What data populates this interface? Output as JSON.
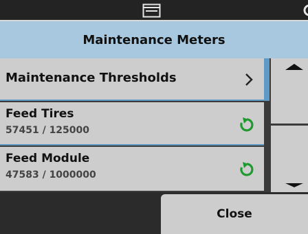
{
  "status_bar": {
    "center_icon": "display-icon"
  },
  "header": {
    "title": "Maintenance Meters"
  },
  "list": {
    "items": [
      {
        "label": "Maintenance Thresholds",
        "icon": "chevron-right-icon"
      },
      {
        "label": "Feed Tires",
        "value": "57451 / 125000",
        "icon": "reset-icon"
      },
      {
        "label": "Feed Module",
        "value": "47583 / 1000000",
        "icon": "reset-icon"
      }
    ]
  },
  "footer": {
    "close_label": "Close"
  },
  "colors": {
    "accent": "#5f9ac6",
    "title_bg": "#a8c8e0",
    "reset_green": "#1f9a2e",
    "row_bg": "#cdcdcd"
  }
}
